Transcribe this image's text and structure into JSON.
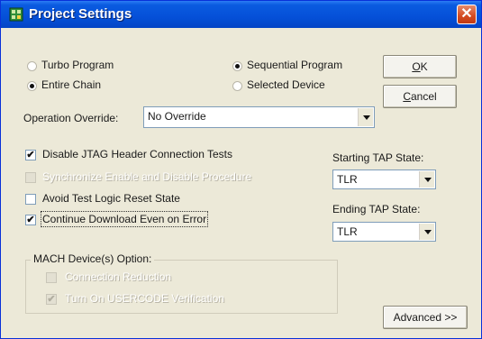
{
  "window": {
    "title": "Project Settings",
    "close_glyph": "✕"
  },
  "program_mode": {
    "options": [
      {
        "label": "Turbo Program",
        "checked": false
      },
      {
        "label": "Sequential Program",
        "checked": true
      },
      {
        "label": "Entire Chain",
        "checked": true
      },
      {
        "label": "Selected Device",
        "checked": false
      }
    ]
  },
  "buttons": {
    "ok_key": "O",
    "ok_rest": "K",
    "cancel_key": "C",
    "cancel_rest": "ancel",
    "advanced": "Advanced >>"
  },
  "operation_override": {
    "label": "Operation Override:",
    "value": "No Override"
  },
  "options": [
    {
      "label": "Disable JTAG Header Connection Tests",
      "checked": true,
      "enabled": true
    },
    {
      "label": "Synchronize Enable and Disable Procedure",
      "checked": false,
      "enabled": false
    },
    {
      "label": "Avoid Test Logic Reset State",
      "checked": false,
      "enabled": true
    },
    {
      "label": "Continue Download Even on Error",
      "checked": true,
      "enabled": true
    }
  ],
  "tap": {
    "starting_label": "Starting TAP State:",
    "starting_value": "TLR",
    "ending_label": "Ending TAP State:",
    "ending_value": "TLR"
  },
  "mach": {
    "group_label": "MACH Device(s) Option:",
    "items": [
      {
        "label": "Connection Reduction",
        "checked": false,
        "enabled": false
      },
      {
        "label": "Turn On USERCODE Verification",
        "checked": true,
        "enabled": false
      }
    ]
  },
  "check_glyph": "✔",
  "icons": {
    "app": "project-settings-icon",
    "close": "close-icon",
    "dropdown": "chevron-down-icon"
  },
  "colors": {
    "titlebar": "#0550d8",
    "close": "#d44a21",
    "face": "#ece9d8"
  }
}
